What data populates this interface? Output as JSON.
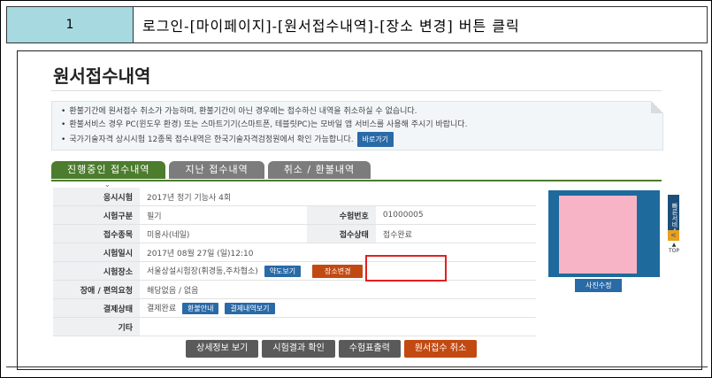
{
  "header": {
    "step": "1",
    "instruction": "로그인-[마이페이지]-[원서접수내역]-[장소 변경] 버튼 클릭"
  },
  "page": {
    "title": "원서접수내역",
    "notices": [
      "환불기간에 원서접수 취소가 가능하며, 환불기간이 아닌 경우에는 접수하신 내역을 취소하실 수 없습니다.",
      "환불서비스 경우 PC(윈도우 환경) 또는 스마트기기(스마트폰, 테블릿PC)는 모바일 앱 서비스를 사용해 주시기 바랍니다.",
      "국가기술자격 상시시험 12종목 접수내역은 한국기술자격검정원에서 확인 가능합니다."
    ],
    "shortcut_button": "바로가기",
    "tabs": [
      "진행중인 접수내역",
      "지난 접수내역",
      "취소 / 환불내역"
    ],
    "fields": {
      "exam_label": "응시시험",
      "exam_value": "2017년 정기 기능사 4회",
      "type_label": "시험구분",
      "type_value": "필기",
      "ticket_label": "수험번호",
      "ticket_value": "01000005",
      "subject_label": "접수종목",
      "subject_value": "미용사(네일)",
      "status_label": "접수상태",
      "status_value": "접수완료",
      "datetime_label": "시험일시",
      "datetime_value": "2017년 08월 27일 (일)12:10",
      "place_label": "시험장소",
      "place_value": "서울상설시험장(휘경동,주차협소)",
      "map_button": "약도보기",
      "change_place_button": "장소변경",
      "disability_label": "장애 / 편의요청",
      "disability_value": "해당없음 / 없음",
      "payment_label": "결제상태",
      "payment_value": "결제완료",
      "refund_button": "환불안내",
      "payment_detail_button": "결제내역보기",
      "etc_label": "기타",
      "etc_value": ""
    },
    "photo_button": "사진수정",
    "quick_service": "빠른서비스",
    "top_label": "TOP",
    "actions": [
      "상세정보 보기",
      "시험결과 확인",
      "수험표출력",
      "원서접수 취소"
    ]
  }
}
